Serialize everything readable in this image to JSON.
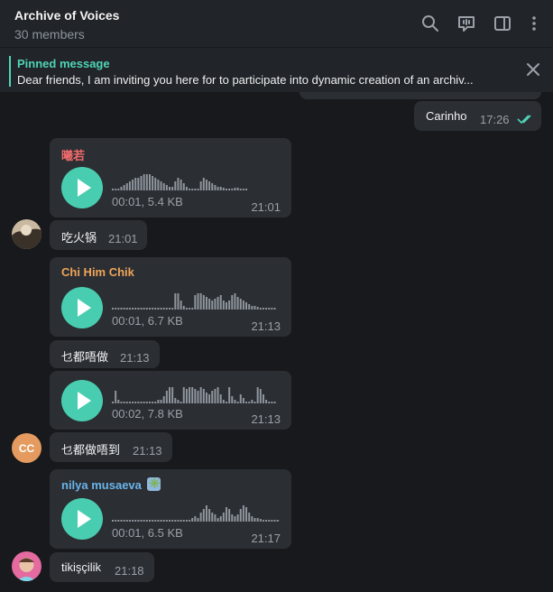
{
  "header": {
    "title": "Archive of Voices",
    "subtitle": "30 members",
    "icons": [
      "search-icon",
      "video-chat-icon",
      "sidebar-toggle-icon",
      "more-vertical-icon"
    ]
  },
  "pinned": {
    "title": "Pinned message",
    "text": "Dear friends, I am inviting you here for to participate into dynamic creation of an archiv..."
  },
  "messages": {
    "out1": {
      "text": "Carinho",
      "time": "17:26",
      "status": "read"
    },
    "v1": {
      "sender": "曦若",
      "sender_color": "#ee6a6a",
      "duration": "00:01, 5.4 KB",
      "time": "21:01",
      "progress": 0
    },
    "t1": {
      "text": "吃火锅",
      "time": "21:01"
    },
    "v2": {
      "sender": "Chi Him Chik",
      "sender_color": "#efa45a",
      "duration": "00:01, 6.7 KB",
      "time": "21:13",
      "progress": 0
    },
    "t2": {
      "text": "乜都唔做",
      "time": "21:13"
    },
    "v3": {
      "duration": "00:02, 7.8 KB",
      "time": "21:13",
      "progress": 0
    },
    "t3": {
      "text": "乜都做唔到",
      "time": "21:13"
    },
    "v4": {
      "sender": "nilya musaeva",
      "sender_color": "#6ab4ea",
      "badge": "✳️",
      "duration": "00:01, 6.5 KB",
      "time": "21:17",
      "progress": 0
    },
    "t4": {
      "text": "tikişçilik",
      "time": "21:18"
    }
  },
  "avatars": {
    "cc_initials": "CC",
    "cc_color": "#e59b5f"
  },
  "colors": {
    "accent": "#4ed5b6",
    "bubble": "#2b2e33",
    "background": "#17191c",
    "header": "#212428"
  }
}
